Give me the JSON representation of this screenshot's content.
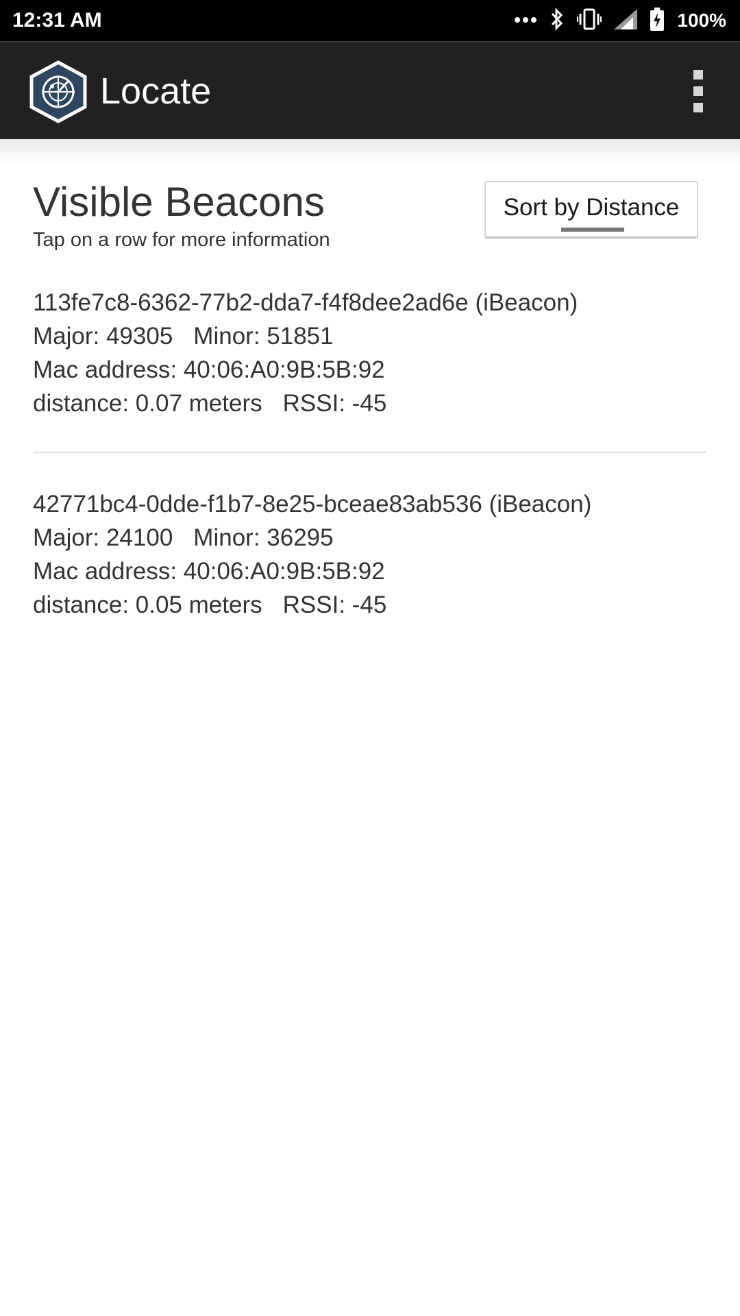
{
  "status_bar": {
    "time": "12:31 AM",
    "icons": [
      "more-dots-icon",
      "bluetooth-icon",
      "vibrate-icon",
      "cell-signal-icon",
      "battery-charging-icon"
    ],
    "battery": "100%"
  },
  "app_bar": {
    "title": "Locate",
    "logo_icon": "radar-hexagon-icon",
    "menu_icon": "overflow-menu-icon"
  },
  "header": {
    "title": "Visible Beacons",
    "subtitle": "Tap on a row for more information",
    "sort_button_label": "Sort by Distance"
  },
  "beacons": [
    {
      "id": "113fe7c8-6362-77b2-dda7-f4f8dee2ad6e (iBeacon)",
      "major": "Major: 49305",
      "minor": "Minor: 51851",
      "mac": "Mac address: 40:06:A0:9B:5B:92",
      "distance": "distance: 0.07 meters",
      "rssi": "RSSI: -45"
    },
    {
      "id": "42771bc4-0dde-f1b7-8e25-bceae83ab536 (iBeacon)",
      "major": "Major: 24100",
      "minor": "Minor: 36295",
      "mac": "Mac address: 40:06:A0:9B:5B:92",
      "distance": "distance: 0.05 meters",
      "rssi": "RSSI: -45"
    }
  ],
  "colors": {
    "app_bar": "#212121",
    "status_bar": "#000000",
    "logo": "#2f4660",
    "text": "#333333"
  }
}
